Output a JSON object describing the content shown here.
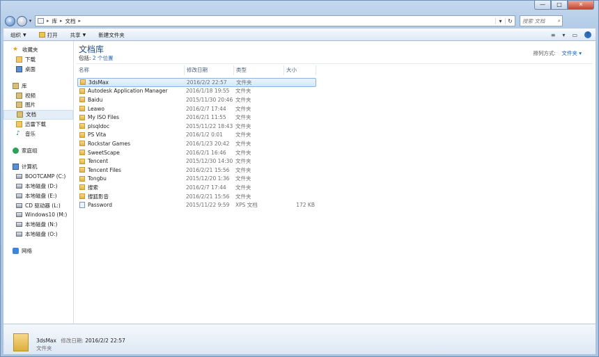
{
  "window": {
    "caption_min": "—",
    "caption_max": "□",
    "caption_close": "✕"
  },
  "nav": {
    "back_icon": "back-arrow-icon",
    "forward_icon": "forward-arrow-icon",
    "dropdown": "▾"
  },
  "address": {
    "crumbs": [
      "库",
      "文档"
    ],
    "separator": "▸",
    "dropdown": "▾",
    "refresh": "↻"
  },
  "search": {
    "placeholder": "搜索 文档"
  },
  "toolbar": {
    "organize": "组织",
    "open": "打开",
    "share": "共享",
    "new_folder": "新建文件夹",
    "views_icon": "≡",
    "preview_icon": "▭"
  },
  "sidebar": {
    "favorites": "收藏夹",
    "favorites_items": [
      "下载",
      "桌面"
    ],
    "libraries": "库",
    "library_items": [
      "视频",
      "图片",
      "文档",
      "迅雷下载",
      "音乐"
    ],
    "homegroup": "家庭组",
    "computer": "计算机",
    "drives": [
      "BOOTCAMP (C:)",
      "本地磁盘 (D:)",
      "本地磁盘 (E:)",
      "CD 驱动器 (L:)",
      "Windows10 (M:)",
      "本地磁盘 (N:)",
      "本地磁盘 (O:)"
    ],
    "network": "网络"
  },
  "library": {
    "title": "文档库",
    "includes_label": "包括:",
    "locations_link": "2 个位置",
    "arrange_label": "排列方式:",
    "arrange_value": "文件夹 ▾"
  },
  "columns": {
    "name": "名称",
    "date": "修改日期",
    "type": "类型",
    "size": "大小"
  },
  "files": [
    {
      "name": "3dsMax",
      "date": "2016/2/2 22:57",
      "type": "文件夹",
      "size": "",
      "kind": "folder"
    },
    {
      "name": "Autodesk Application Manager",
      "date": "2016/1/18 19:55",
      "type": "文件夹",
      "size": "",
      "kind": "folder"
    },
    {
      "name": "Baidu",
      "date": "2015/11/30 20:46",
      "type": "文件夹",
      "size": "",
      "kind": "folder"
    },
    {
      "name": "Leawo",
      "date": "2016/2/7 17:44",
      "type": "文件夹",
      "size": "",
      "kind": "folder"
    },
    {
      "name": "My ISO Files",
      "date": "2016/2/1 11:55",
      "type": "文件夹",
      "size": "",
      "kind": "folder"
    },
    {
      "name": "plsqldoc",
      "date": "2015/11/22 18:43",
      "type": "文件夹",
      "size": "",
      "kind": "folder"
    },
    {
      "name": "PS Vita",
      "date": "2016/1/2 0:01",
      "type": "文件夹",
      "size": "",
      "kind": "folder"
    },
    {
      "name": "Rockstar Games",
      "date": "2016/1/23 20:42",
      "type": "文件夹",
      "size": "",
      "kind": "folder"
    },
    {
      "name": "SweetScape",
      "date": "2016/2/1 16:46",
      "type": "文件夹",
      "size": "",
      "kind": "folder"
    },
    {
      "name": "Tencent",
      "date": "2015/12/30 14:30",
      "type": "文件夹",
      "size": "",
      "kind": "folder"
    },
    {
      "name": "Tencent Files",
      "date": "2016/2/21 15:56",
      "type": "文件夹",
      "size": "",
      "kind": "folder"
    },
    {
      "name": "Tongbu",
      "date": "2015/12/20 1:36",
      "type": "文件夹",
      "size": "",
      "kind": "folder"
    },
    {
      "name": "搜索",
      "date": "2016/2/7 17:44",
      "type": "文件夹",
      "size": "",
      "kind": "folder"
    },
    {
      "name": "搜狐影音",
      "date": "2016/2/21 15:56",
      "type": "文件夹",
      "size": "",
      "kind": "folder"
    },
    {
      "name": "Password",
      "date": "2015/11/22 9:59",
      "type": "XPS 文档",
      "size": "172 KB",
      "kind": "xps"
    }
  ],
  "selected_index": 0,
  "details": {
    "name": "3dsMax",
    "date_label": "修改日期:",
    "date": "2016/2/2 22:57",
    "type": "文件夹"
  }
}
